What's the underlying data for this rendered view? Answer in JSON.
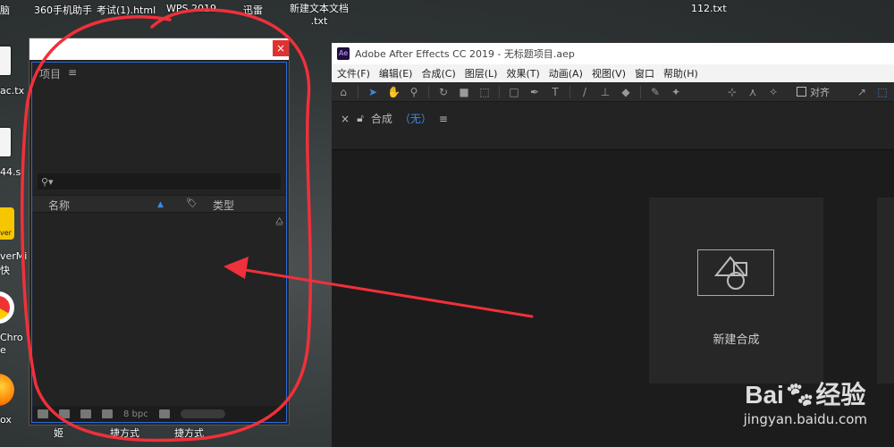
{
  "desktop": {
    "top_labels": [
      "脑",
      "360手机助手",
      "考试(1).html",
      "WPS 2019",
      "迅雷",
      "新建文本文档",
      ".txt",
      "112.txt"
    ],
    "left_labels": [
      "ac.tx",
      "44.s",
      "ver",
      "verMi",
      "快",
      "Chro",
      "e",
      "ox"
    ],
    "bottom_labels": [
      "姬",
      "捷方式",
      "捷方式"
    ]
  },
  "project_panel": {
    "close_glyph": "×",
    "tab_label": "项目",
    "menu_glyph": "≡",
    "search_glyph": "⚲▾",
    "columns": {
      "name": "名称",
      "type": "类型"
    },
    "footer_bpc": "8 bpc"
  },
  "ae": {
    "logo": "Ae",
    "title": "Adobe After Effects CC 2019 - 无标题项目.aep",
    "menu": [
      "文件(F)",
      "编辑(E)",
      "合成(C)",
      "图层(L)",
      "效果(T)",
      "动画(A)",
      "视图(V)",
      "窗口",
      "帮助(H)"
    ],
    "tools": [
      "home-icon",
      "selection-icon",
      "hand-icon",
      "zoom-icon",
      "rotate-icon",
      "camera-icon",
      "pan-icon",
      "rectangle-icon",
      "pen-icon",
      "text-icon",
      "brush-icon",
      "clone-icon",
      "eraser-icon",
      "roto-icon",
      "puppet-icon"
    ],
    "align_label": "对齐",
    "comp_tab": {
      "close": "×",
      "label": "合成",
      "value": "（无）",
      "menu": "≡"
    },
    "new_comp_label": "新建合成"
  },
  "watermark": {
    "brand": "Bai",
    "brand_cn": "经验",
    "url": "jingyan.baidu.com"
  },
  "colors": {
    "annotation": "#f0303a",
    "ae_blue": "#3b8be0"
  }
}
